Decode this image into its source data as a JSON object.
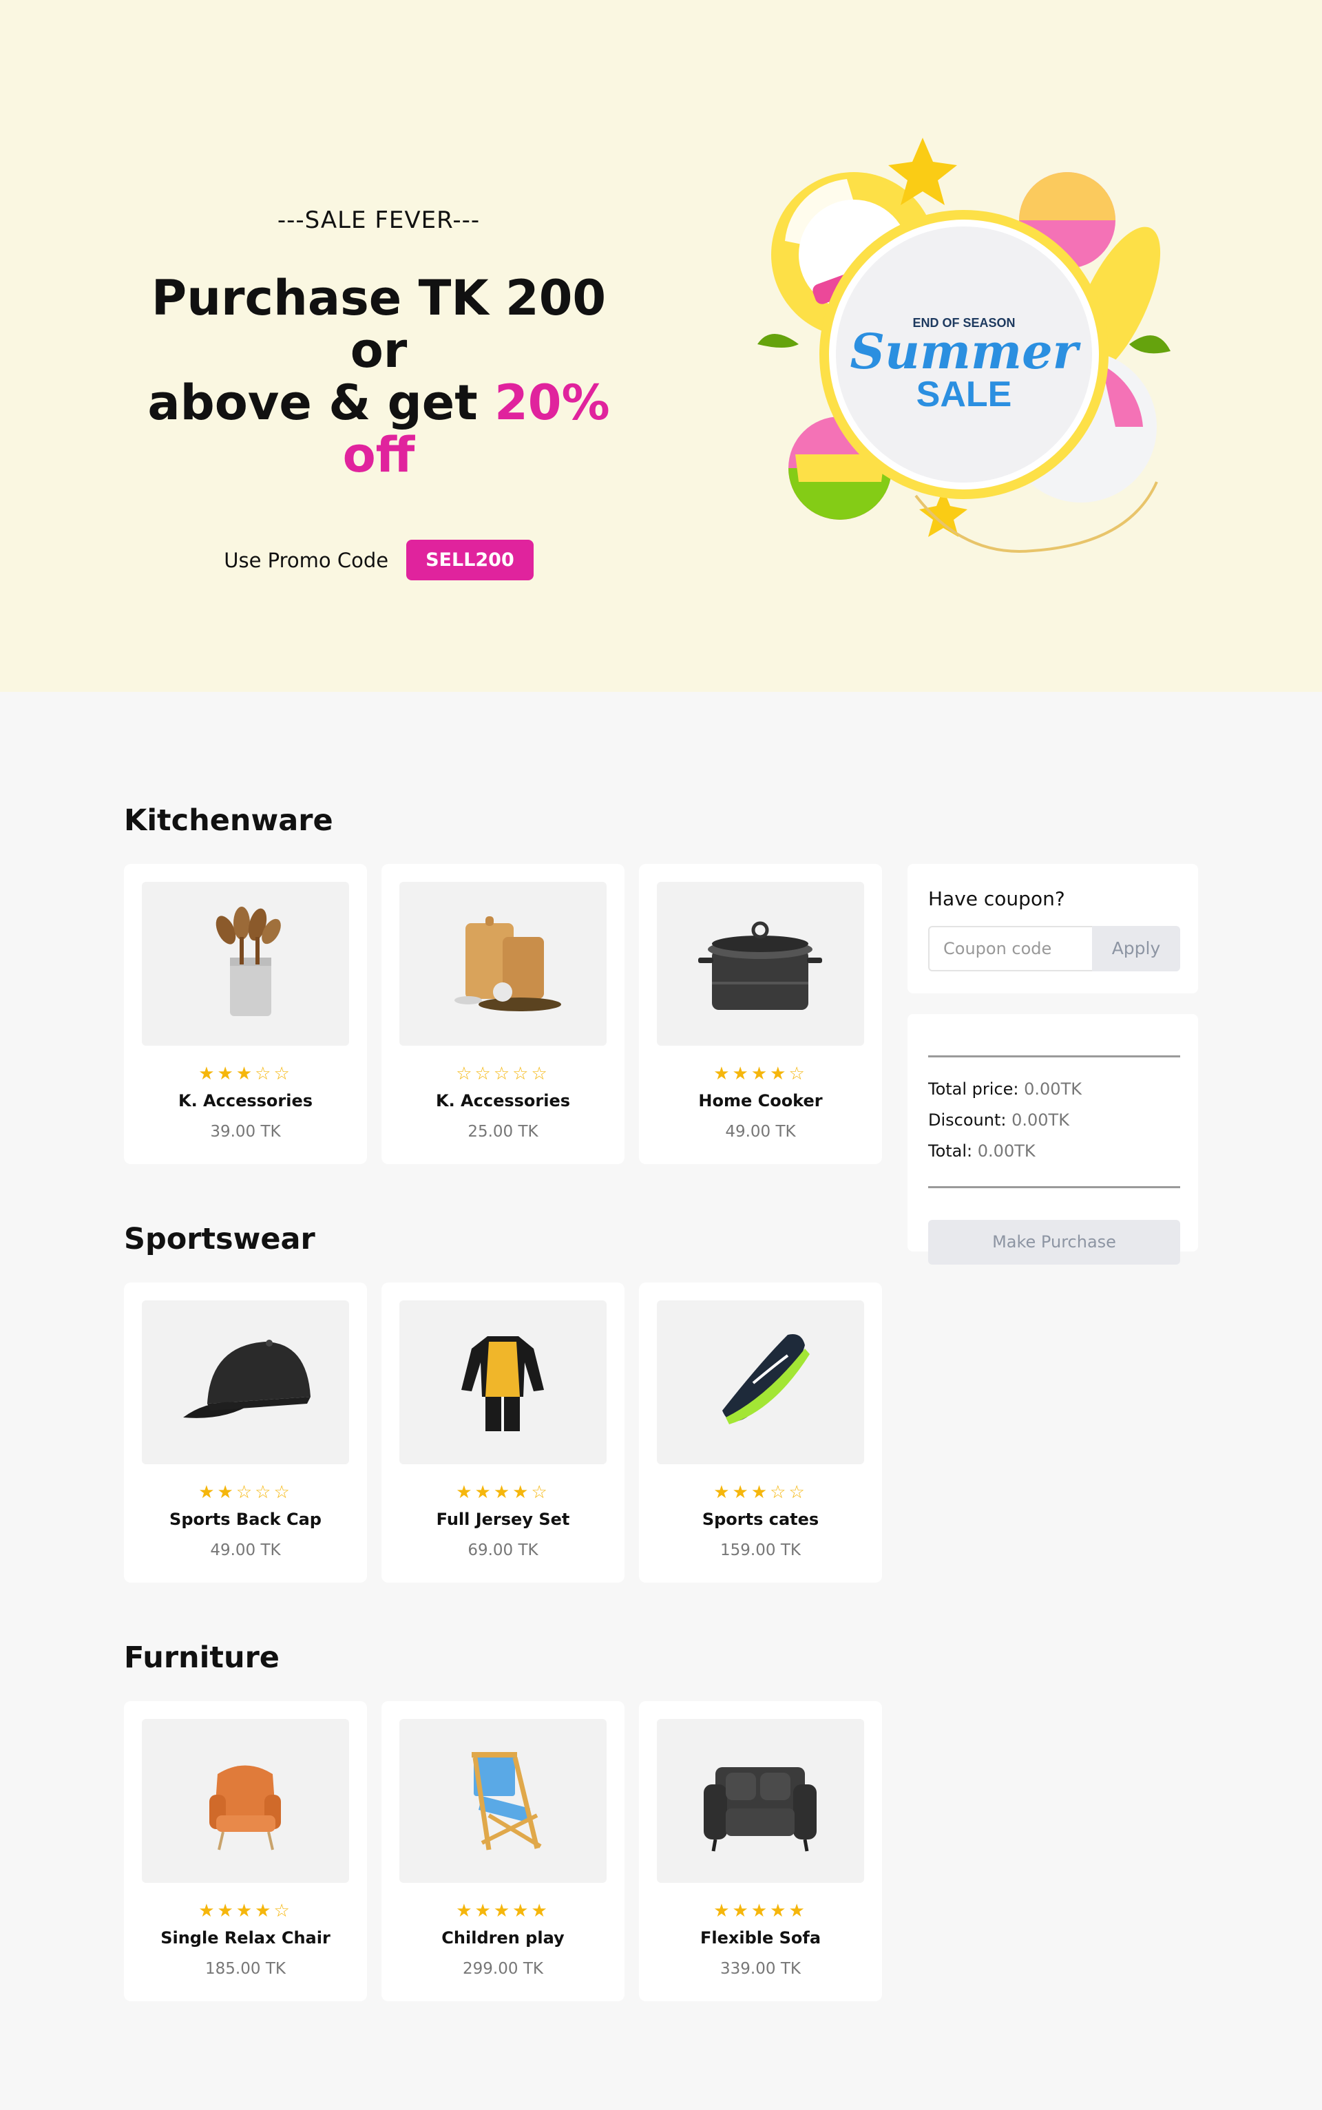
{
  "hero": {
    "eyebrow": "---SALE FEVER---",
    "headline_line1": "Purchase TK 200 or",
    "headline_line2_prefix": "above & get ",
    "headline_accent": "20% off",
    "promo_label": "Use Promo Code",
    "promo_code": "SELL200",
    "badge": {
      "top": "END OF SEASON",
      "script": "Summer",
      "bottom": "SALE"
    }
  },
  "sections": [
    {
      "title": "Kitchenware",
      "products": [
        {
          "name": "K. Accessories",
          "price": "39.00 TK",
          "rating": 3,
          "icon": "kitchen-utensils-icon"
        },
        {
          "name": "K. Accessories",
          "price": "25.00 TK",
          "rating": 0,
          "icon": "cutting-board-icon"
        },
        {
          "name": "Home Cooker",
          "price": "49.00 TK",
          "rating": 4,
          "icon": "cooking-pot-icon"
        }
      ]
    },
    {
      "title": "Sportswear",
      "products": [
        {
          "name": "Sports Back Cap",
          "price": "49.00 TK",
          "rating": 2,
          "icon": "cap-icon"
        },
        {
          "name": "Full Jersey Set",
          "price": "69.00 TK",
          "rating": 4,
          "icon": "jersey-icon"
        },
        {
          "name": "Sports cates",
          "price": "159.00 TK",
          "rating": 3,
          "icon": "sneaker-icon"
        }
      ]
    },
    {
      "title": "Furniture",
      "products": [
        {
          "name": "Single Relax Chair",
          "price": "185.00 TK",
          "rating": 4,
          "icon": "armchair-icon"
        },
        {
          "name": "Children play",
          "price": "299.00 TK",
          "rating": 5,
          "icon": "folding-chair-icon"
        },
        {
          "name": "Flexible Sofa",
          "price": "339.00 TK",
          "rating": 5,
          "icon": "sofa-icon"
        }
      ]
    }
  ],
  "coupon": {
    "title": "Have coupon?",
    "placeholder": "Coupon code",
    "apply_label": "Apply"
  },
  "summary": {
    "total_price_label": "Total price:",
    "total_price_value": "0.00TK",
    "discount_label": "Discount:",
    "discount_value": "0.00TK",
    "total_label": "Total:",
    "total_value": "0.00TK",
    "purchase_label": "Make Purchase"
  },
  "colors": {
    "accent": "#e0239d",
    "hero_bg": "#faf7e1",
    "star": "#f5b60c"
  }
}
